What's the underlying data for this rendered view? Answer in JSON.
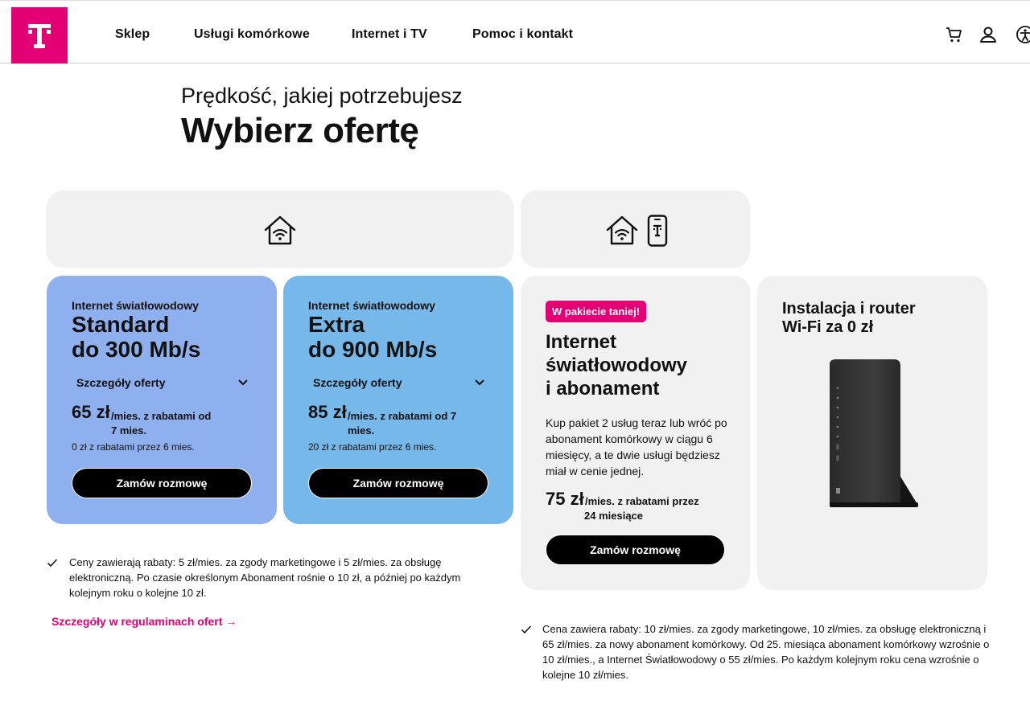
{
  "header": {
    "logo_letter": "T",
    "nav": [
      "Sklep",
      "Usługi komórkowe",
      "Internet i TV",
      "Pomoc i kontakt"
    ],
    "icons": [
      "cart-icon",
      "user-icon",
      "accessibility-icon"
    ]
  },
  "page": {
    "subtitle": "Prędkość, jakiej potrzebujesz",
    "title": "Wybierz ofertę"
  },
  "categories": {
    "left_icon": "home-wifi-icon",
    "right_icons": [
      "home-wifi-icon",
      "phone-icon"
    ]
  },
  "offers": [
    {
      "kicker": "Internet światłowodowy",
      "name_line1": "Standard",
      "name_line2": "do 300 Mb/s",
      "details_label": "Szczegóły oferty",
      "price": "65 zł",
      "price_suffix": "/mies. z rabatami od",
      "price_suffix2": "7 mies.",
      "note": "0 zł z rabatami przez 6 mies.",
      "button": "Zamów rozmowę",
      "color": "#8fb0ee"
    },
    {
      "kicker": "Internet światłowodowy",
      "name_line1": "Extra",
      "name_line2": "do 900 Mb/s",
      "details_label": "Szczegóły oferty",
      "price": "85 zł",
      "price_suffix": "/mies. z rabatami od 7",
      "price_suffix2": "mies.",
      "note": "20 zł z rabatami przez 6 mies.",
      "button": "Zamów rozmowę",
      "color": "#77b8eb"
    }
  ],
  "bundle": {
    "badge": "W pakiecie taniej!",
    "title_line1": "Internet",
    "title_line2": "światłowodowy",
    "title_line3": "i abonament",
    "description": "Kup pakiet 2 usług teraz lub wróć po abonament komórkowy w ciągu 6 miesięcy, a te dwie usługi będziesz miał w cenie jednej.",
    "price": "75 zł",
    "price_suffix": "/mies. z rabatami przez",
    "price_suffix2": "24 miesiące",
    "button": "Zamów rozmowę"
  },
  "router": {
    "title_line1": "Instalacja i router",
    "title_line2": "Wi-Fi za 0 zł"
  },
  "notes": {
    "left": "Ceny zawierają rabaty: 5 zł/mies. za zgody marketingowe i 5 zł/mies. za obsługę elektroniczną. Po czasie określonym Abonament rośnie o 10 zł, a później po każdym kolejnym roku o kolejne 10 zł.",
    "terms_link": "Szczegóły w regulaminach ofert →",
    "right": "Cena zawiera rabaty: 10 zł/mies. za zgody marketingowe, 10 zł/mies. za obsługę elektroniczną i 65 zł/mies. za nowy abonament komórkowy. Od 25. miesiąca abonament komórkowy wzrośnie o 10 zł/mies., a Internet Światłowodowy o 55 zł/mies. Po każdym kolejnym roku cena wzrośnie o kolejne 10 zł/mies."
  },
  "colors": {
    "brand": "#e20074",
    "panel": "#f1f1f1"
  }
}
